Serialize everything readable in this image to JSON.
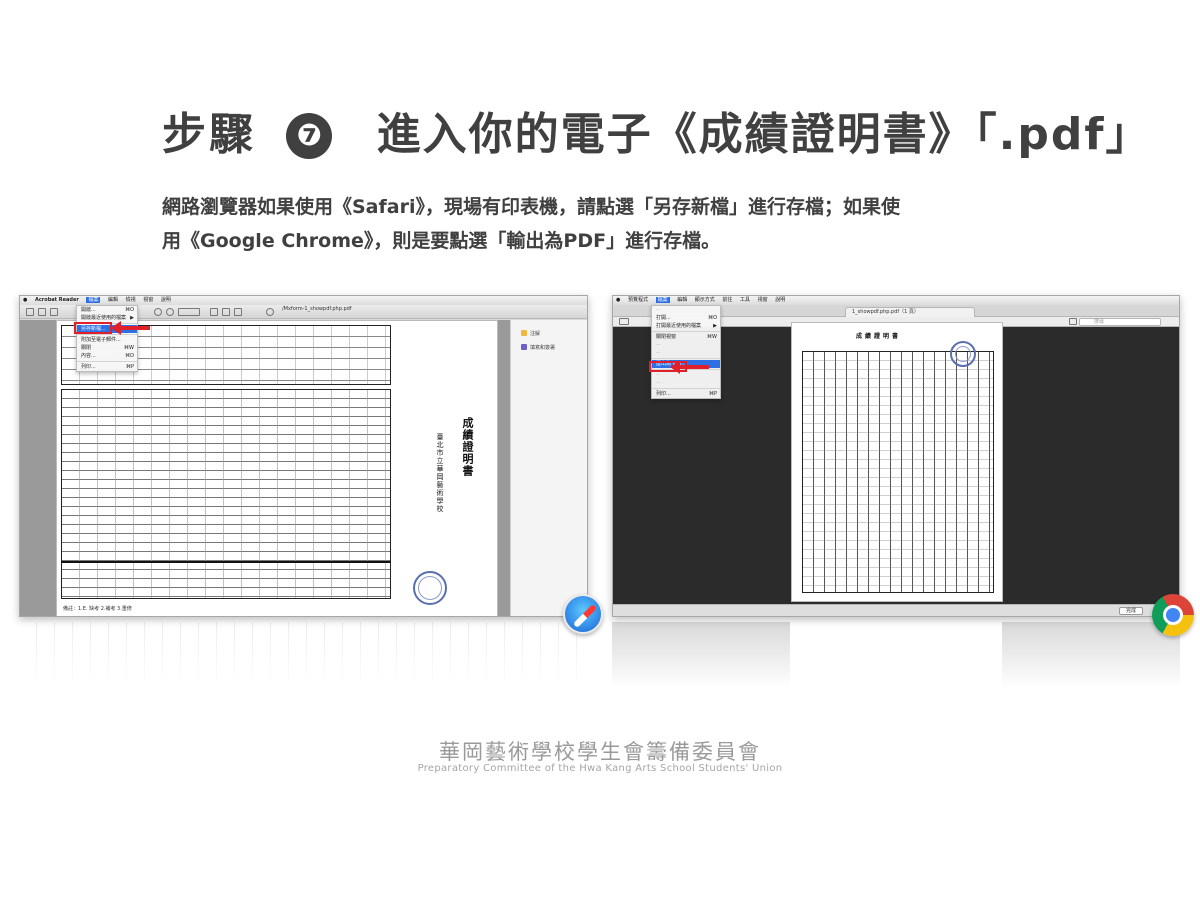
{
  "heading": {
    "step_label": "步驟",
    "step_number": "❼",
    "title": "進入你的電子《成績證明書》「.pdf」"
  },
  "instructions": {
    "line1": "網路瀏覽器如果使用《Safari》，現場有印表機，請點選「另存新檔」進行存檔；如果使",
    "line2": "用《Google Chrome》，則是要點選「輸出為PDF」進行存檔。"
  },
  "safari_screenshot": {
    "app_name": "Acrobat Reader",
    "menus": [
      "檔案",
      "編輯",
      "檢視",
      "視窗",
      "說明"
    ],
    "active_menu": "檔案",
    "window_title": "/Mxform-1_showpdf.php.pdf",
    "file_menu_items": [
      {
        "label": "開啟...",
        "shortcut": "⌘O"
      },
      {
        "label": "開啟最近使用的檔案",
        "shortcut": "▶"
      },
      {
        "label": "另存新檔...",
        "shortcut": "⌘S",
        "highlighted": true
      },
      {
        "label": "附加至電子郵件...",
        "shortcut": ""
      },
      {
        "label": "關閉",
        "shortcut": "⌘W"
      },
      {
        "label": "內容...",
        "shortcut": "⌘D"
      },
      {
        "label": "列印...",
        "shortcut": "⌘P"
      }
    ],
    "side_panel": [
      "注解",
      "填寫和簽署"
    ],
    "document_footer": "備註：1.E. 缺考 2.補考 3.重修",
    "document_title": "成績證明書",
    "school_name": "臺北市立華岡藝術學校"
  },
  "chrome_screenshot": {
    "menus": [
      "預覽程式",
      "檔案",
      "編輯",
      "顯示方式",
      "前往",
      "工具",
      "視窗",
      "說明"
    ],
    "active_menu": "檔案",
    "tab_title": "1_showpdf.php.pdf（1 頁）",
    "file_menu_items": [
      {
        "label": "打開...",
        "shortcut": "⌘O"
      },
      {
        "label": "打開最近使用的檔案",
        "shortcut": "▶"
      },
      {
        "label": "關閉視窗",
        "shortcut": "⌘W"
      },
      {
        "label": "匯出為 PDF...",
        "shortcut": "",
        "highlighted": true
      },
      {
        "label": "列印...",
        "shortcut": "⌘P"
      }
    ],
    "search_placeholder": "搜尋",
    "done_label": "完成",
    "document_title": "成績證明書"
  },
  "footer": {
    "org_cn": "華岡藝術學校學生會籌備委員會",
    "org_en": "Preparatory Committee of the Hwa Kang Arts School Students' Union"
  },
  "colors": {
    "title": "#404040",
    "highlight_box": "#e0202a",
    "menu_selection": "#2d6fe4",
    "footer_text": "#9a9a9a"
  },
  "icons": [
    "safari-icon",
    "chrome-icon"
  ]
}
